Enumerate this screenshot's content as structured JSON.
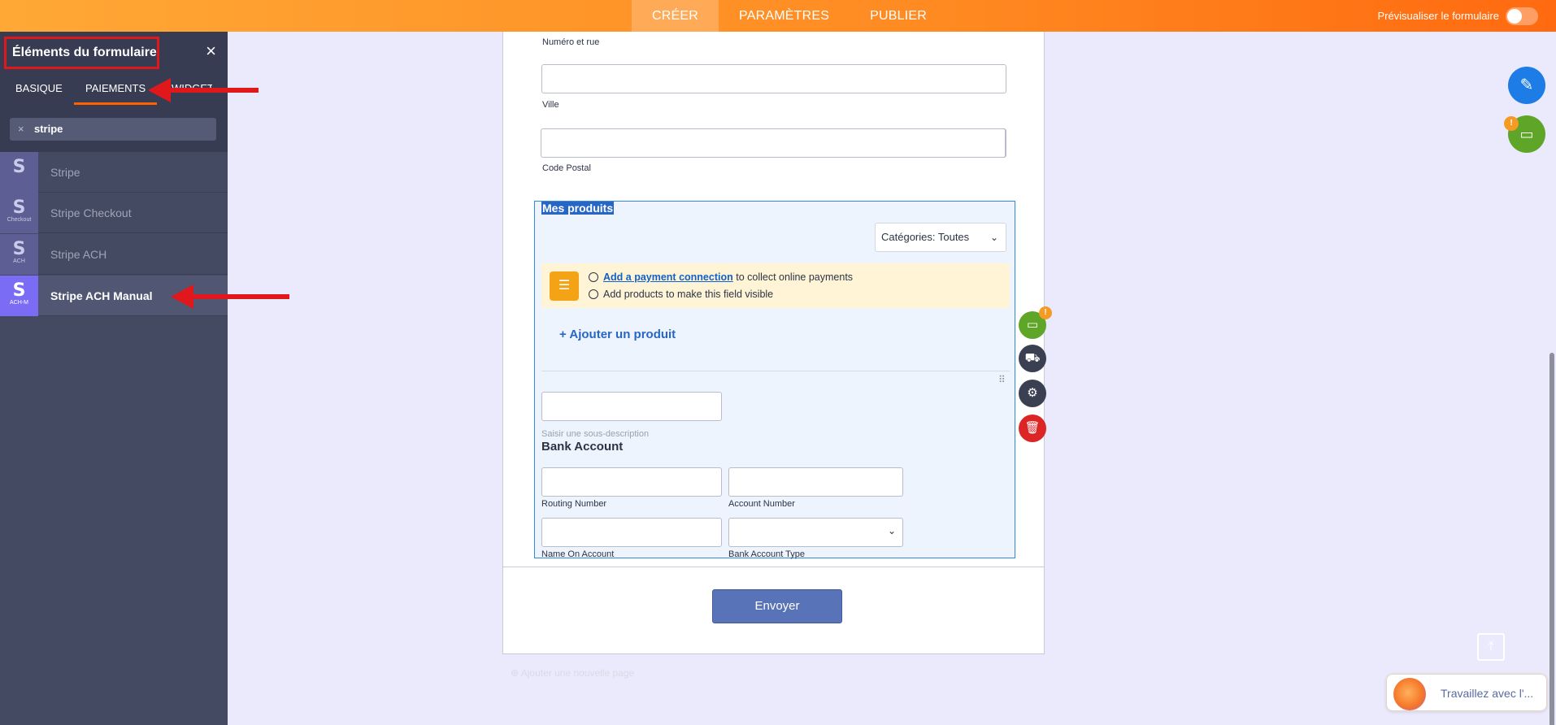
{
  "topbar": {
    "tabs": [
      {
        "label": "CRÉER",
        "active": true
      },
      {
        "label": "PARAMÈTRES",
        "active": false
      },
      {
        "label": "PUBLIER",
        "active": false
      }
    ],
    "preview_label": "Prévisualiser le formulaire"
  },
  "sidebar": {
    "title": "Éléments du formulaire",
    "tabs": [
      {
        "label": "BASIQUE"
      },
      {
        "label": "PAIEMENTS"
      },
      {
        "label": "WIDGETS"
      }
    ],
    "search_value": "stripe",
    "items": [
      {
        "label": "Stripe",
        "icon_sub": ""
      },
      {
        "label": "Stripe Checkout",
        "icon_sub": "Checkout"
      },
      {
        "label": "Stripe ACH",
        "icon_sub": "ACH"
      },
      {
        "label": "Stripe ACH Manual",
        "icon_sub": "ACH-M"
      }
    ],
    "icon_letter": "S"
  },
  "form": {
    "street_label": "Numéro et rue",
    "city_label": "Ville",
    "zip_label": "Code Postal",
    "products_title": "Mes produits",
    "category_select": "Catégories: Toutes",
    "notice_link": "Add a payment connection",
    "notice_line1_rest": " to collect online payments",
    "notice_line2": "Add products to make this field visible",
    "add_product": "+ Ajouter un produit",
    "subdescription_placeholder": "Saisir une sous-description",
    "bank_title": "Bank Account",
    "routing_label": "Routing Number",
    "account_label": "Account Number",
    "name_label": "Name On Account",
    "type_label": "Bank Account Type",
    "submit_label": "Envoyer",
    "add_page": "Ajouter une nouvelle page"
  },
  "chat": {
    "text": "Travaillez avec l'..."
  },
  "colors": {
    "accent": "#ff6100",
    "selection": "#2f8ae0",
    "stripe_active": "#7b6cf6",
    "annotation": "#e0181c"
  }
}
